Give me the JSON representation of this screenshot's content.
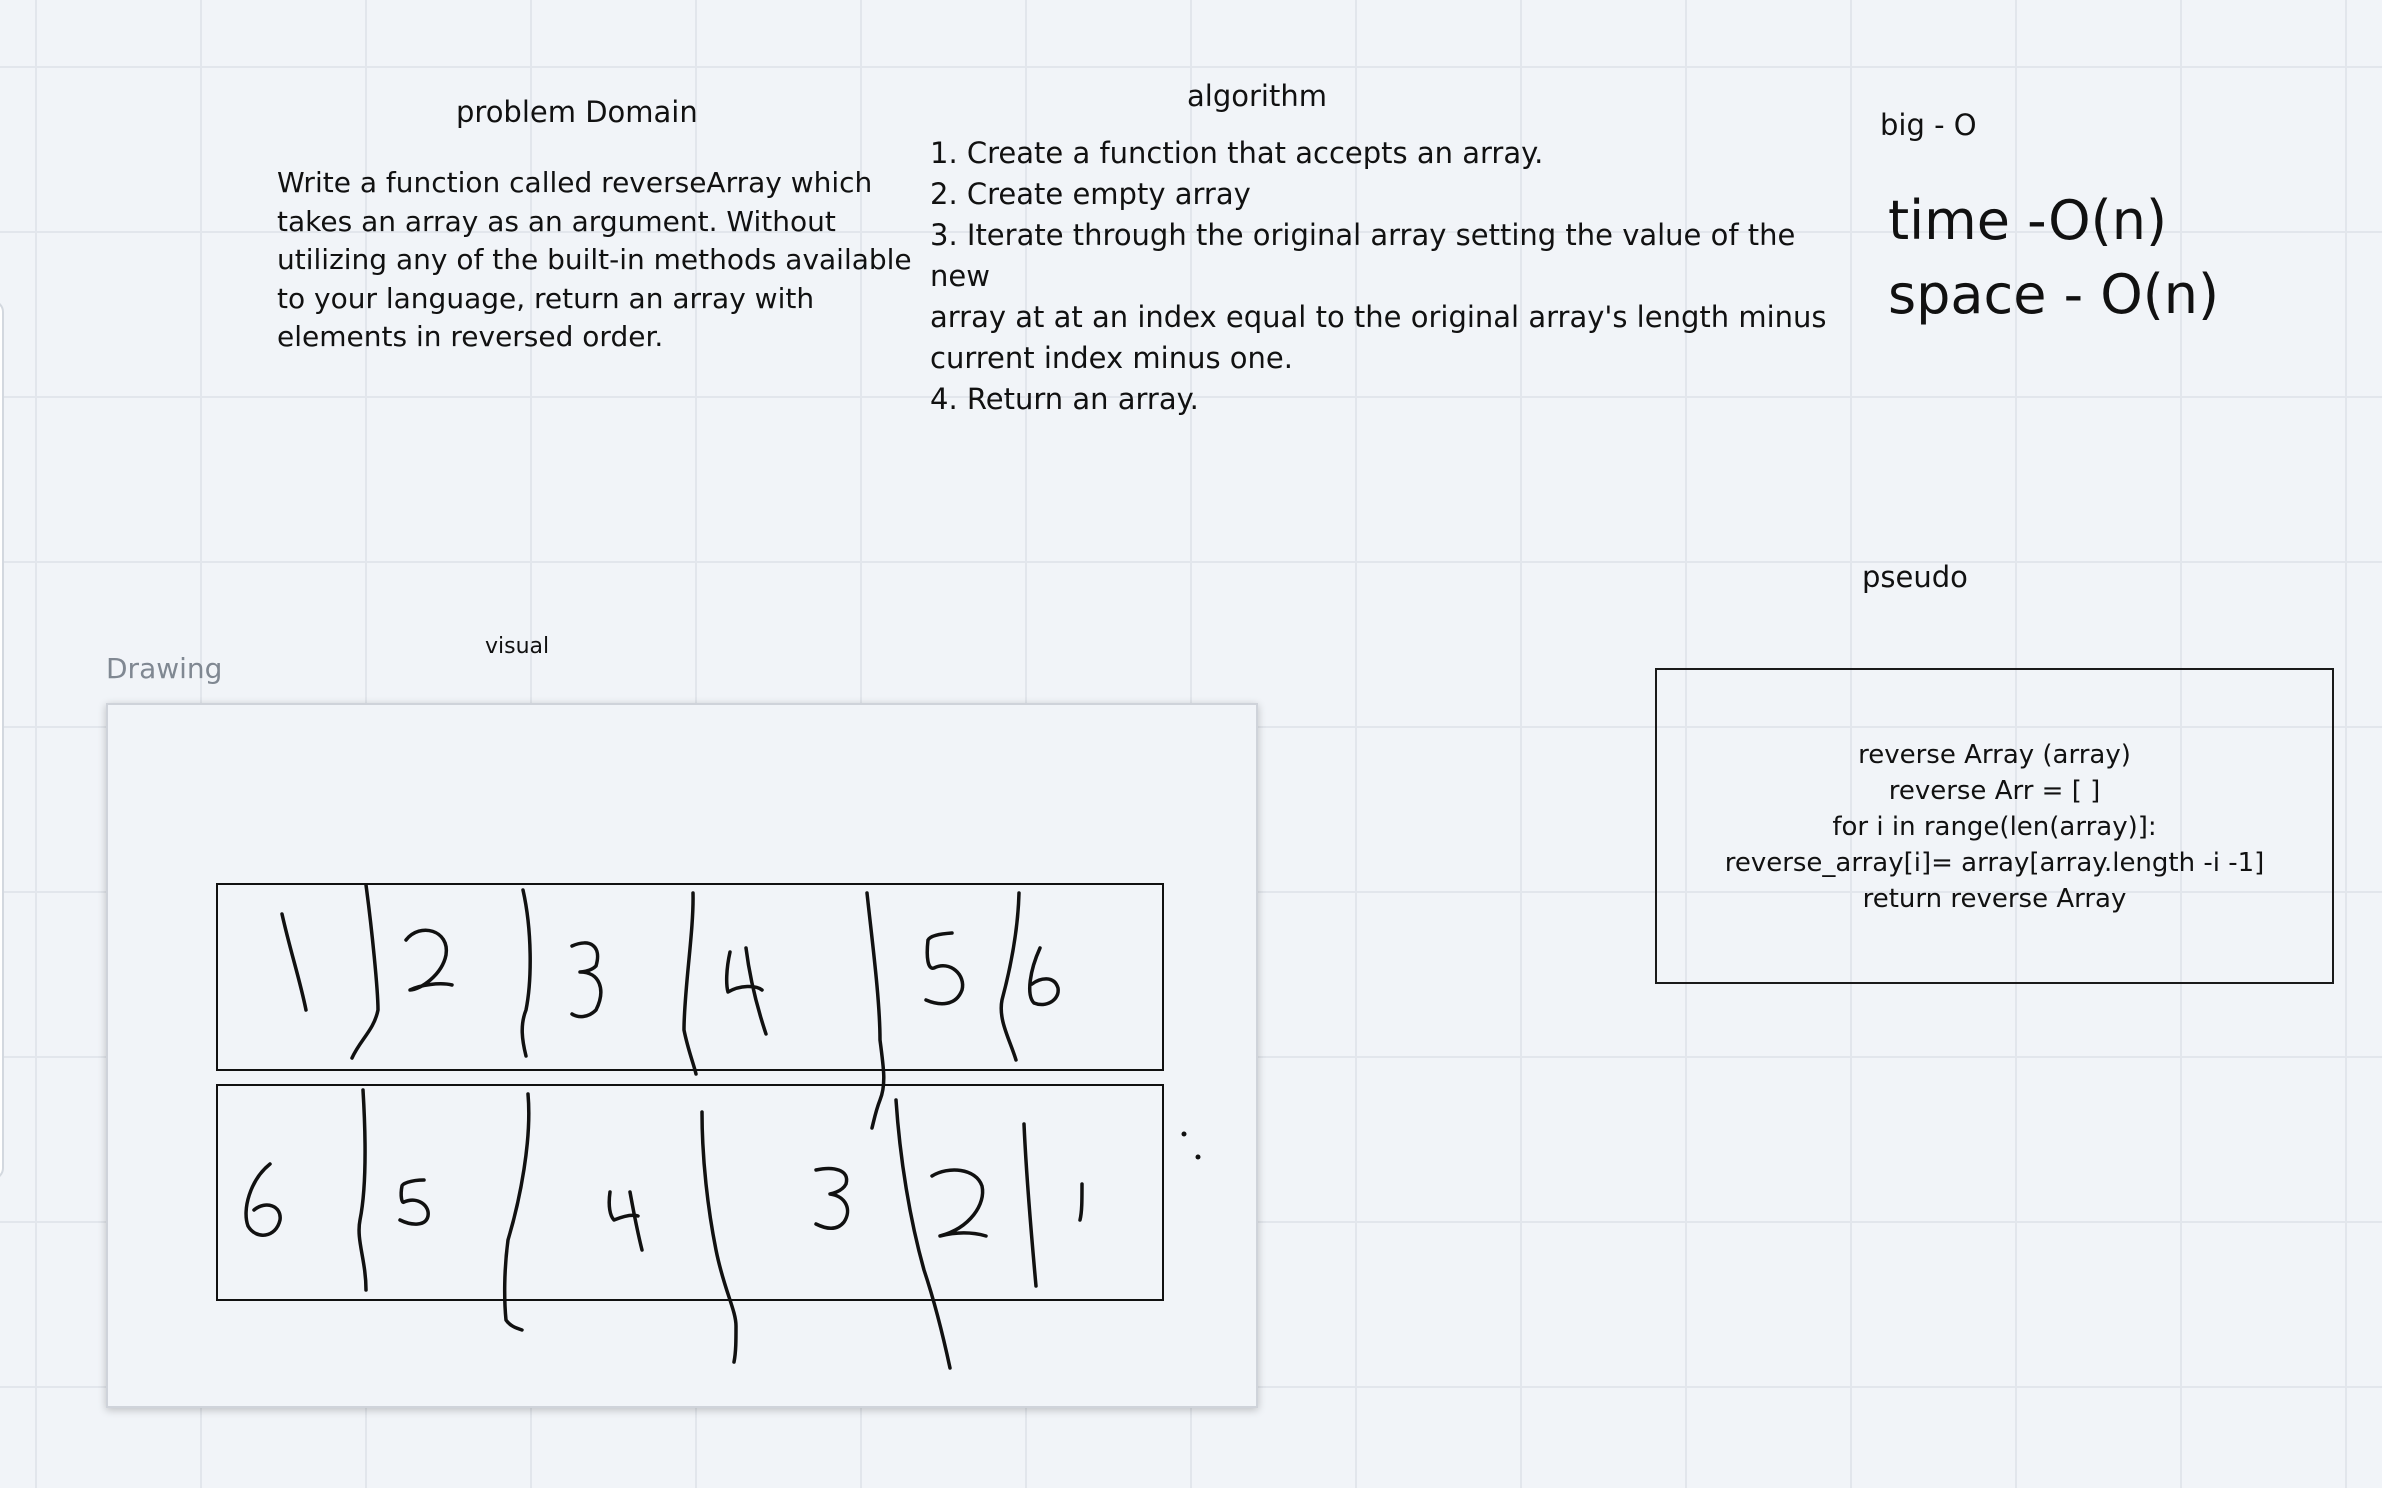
{
  "problem_domain": {
    "heading": "problem Domain",
    "lines": [
      "Write a function called reverseArray which",
      "takes an array as an argument. Without",
      "utilizing any of the built-in methods available",
      "to your language, return an array with",
      "elements in reversed order."
    ]
  },
  "algorithm": {
    "heading": "algorithm",
    "lines": [
      "1. Create a function that accepts an array.",
      "2. Create empty array",
      "3. Iterate through the original array setting the value of the new",
      "array at at an index equal to the original array's length minus",
      "current index minus one.",
      "4. Return an array."
    ]
  },
  "big_o": {
    "heading": "big - O",
    "time": "time -O(n)",
    "space": "space - O(n)"
  },
  "pseudo": {
    "heading": "pseudo",
    "lines": [
      "reverse Array (array)",
      "reverse Arr = [ ]",
      "for i in range(len(array)]:",
      "reverse_array[i]= array[array.length -i -1]",
      "return reverse Array"
    ]
  },
  "visual": {
    "label": "visual",
    "frame_title": "Drawing",
    "top_row": [
      "1",
      "2",
      "3",
      "4",
      "5",
      "6"
    ],
    "bottom_row": [
      "6",
      "5",
      "4",
      "3",
      "2",
      "1"
    ]
  }
}
